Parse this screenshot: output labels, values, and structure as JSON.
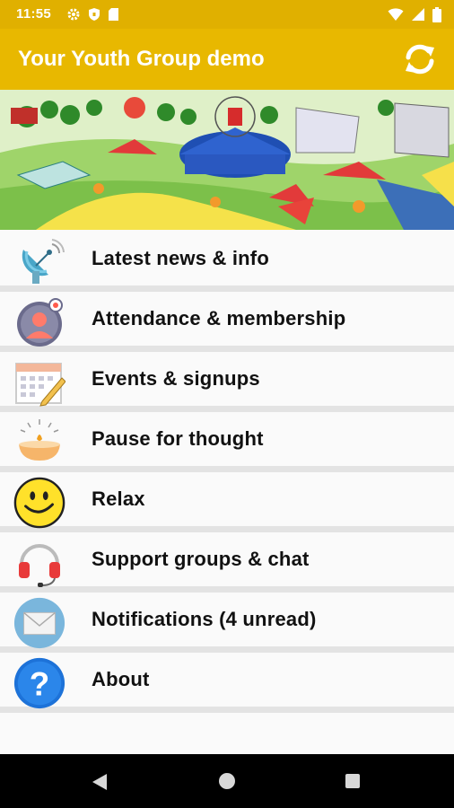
{
  "status": {
    "time": "11:55",
    "icons_left": [
      "gear-icon",
      "shield-icon",
      "sd-card-icon"
    ],
    "icons_right": [
      "wifi-icon",
      "signal-icon",
      "battery-icon"
    ]
  },
  "app_bar": {
    "title": "Your Youth Group demo",
    "refresh_icon": "refresh-icon",
    "background": "#e8b800"
  },
  "banner": {
    "description_icon": "festival-illustration"
  },
  "menu": {
    "items": [
      {
        "label": "Latest news & info",
        "icon": "satellite-dish-icon"
      },
      {
        "label": "Attendance & membership",
        "icon": "user-avatar-icon"
      },
      {
        "label": "Events & signups",
        "icon": "calendar-icon"
      },
      {
        "label": "Pause for thought",
        "icon": "candle-icon"
      },
      {
        "label": "Relax",
        "icon": "smiley-icon"
      },
      {
        "label": "Support groups & chat",
        "icon": "headset-icon"
      },
      {
        "label": "Notifications (4 unread)",
        "icon": "envelope-icon"
      },
      {
        "label": "About",
        "icon": "question-icon"
      }
    ]
  },
  "nav": {
    "back": "back-icon",
    "home": "home-icon",
    "recent": "recent-apps-icon"
  }
}
